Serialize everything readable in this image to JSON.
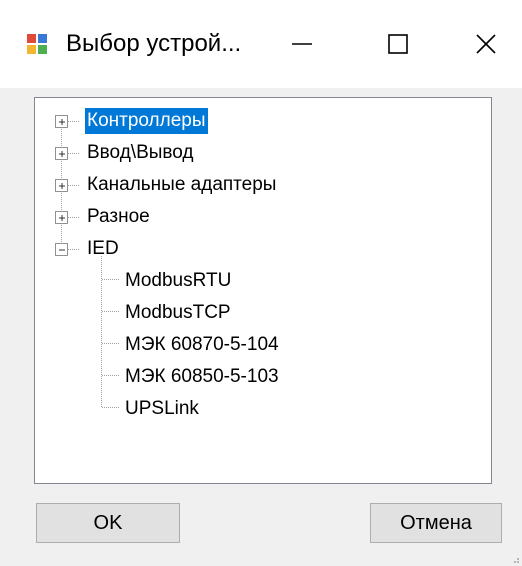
{
  "window": {
    "title": "Выбор устрой...",
    "app_icon": "window-app-icon",
    "controls": {
      "minimize_icon": "minimize-icon",
      "maximize_icon": "maximize-icon",
      "close_icon": "close-icon"
    }
  },
  "tree": {
    "nodes": [
      {
        "label": "Контроллеры",
        "level": 0,
        "state": "collapsed",
        "selected": true
      },
      {
        "label": "Ввод\\Вывод",
        "level": 0,
        "state": "collapsed",
        "selected": false
      },
      {
        "label": "Канальные адаптеры",
        "level": 0,
        "state": "collapsed",
        "selected": false
      },
      {
        "label": "Разное",
        "level": 0,
        "state": "collapsed",
        "selected": false
      },
      {
        "label": "IED",
        "level": 0,
        "state": "expanded",
        "selected": false
      },
      {
        "label": "ModbusRTU",
        "level": 1,
        "state": "leaf",
        "selected": false
      },
      {
        "label": "ModbusTCP",
        "level": 1,
        "state": "leaf",
        "selected": false
      },
      {
        "label": "МЭК 60870-5-104",
        "level": 1,
        "state": "leaf",
        "selected": false
      },
      {
        "label": "МЭК 60850-5-103",
        "level": 1,
        "state": "leaf",
        "selected": false
      },
      {
        "label": "UPSLink",
        "level": 1,
        "state": "leaf",
        "selected": false
      }
    ]
  },
  "buttons": {
    "ok_label": "OK",
    "cancel_label": "Отмена"
  },
  "colors": {
    "selection": "#0078d7",
    "background": "#f0f0f0",
    "titlebar": "#ffffff"
  }
}
